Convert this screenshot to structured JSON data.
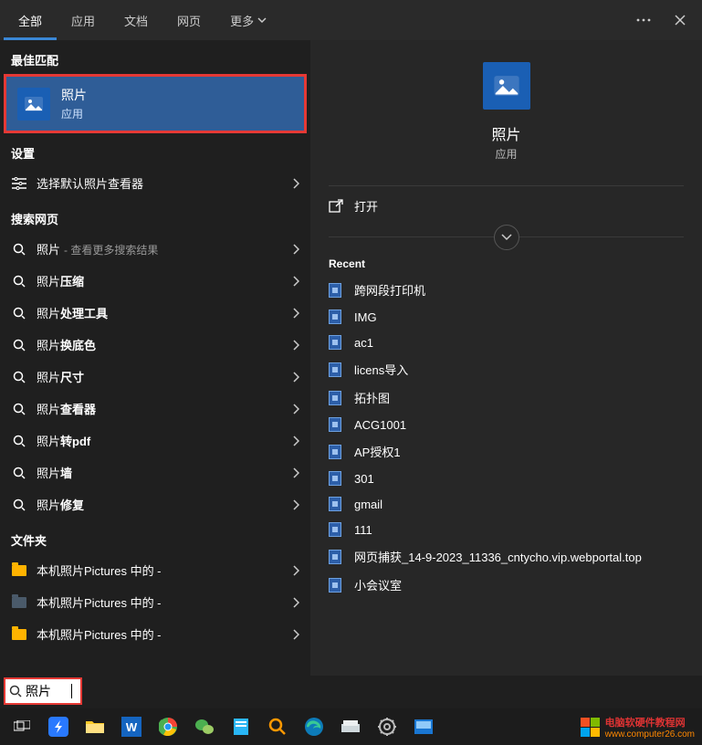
{
  "tabs": {
    "all": "全部",
    "apps": "应用",
    "docs": "文档",
    "web": "网页",
    "more": "更多"
  },
  "left": {
    "best_header": "最佳匹配",
    "best_title": "照片",
    "best_sub": "应用",
    "settings_header": "设置",
    "settings_item": "选择默认照片查看器",
    "web_header": "搜索网页",
    "web_items": [
      {
        "prefix": "照片",
        "suffix": " - 查看更多搜索结果"
      },
      {
        "prefix": "照片",
        "bold": "压缩"
      },
      {
        "prefix": "照片",
        "bold": "处理工具"
      },
      {
        "prefix": "照片",
        "bold": "换底色"
      },
      {
        "prefix": "照片",
        "bold": "尺寸"
      },
      {
        "prefix": "照片",
        "bold": "查看器"
      },
      {
        "prefix": "照片",
        "bold": "转pdf"
      },
      {
        "prefix": "照片",
        "bold": "墙"
      },
      {
        "prefix": "照片",
        "bold": "修复"
      }
    ],
    "folders_header": "文件夹",
    "folders": [
      {
        "name": "本机照片Pictures 中的 -"
      },
      {
        "name": "本机照片Pictures 中的 -"
      },
      {
        "name": "本机照片Pictures 中的 -"
      }
    ]
  },
  "right": {
    "title": "照片",
    "sub": "应用",
    "open": "打开",
    "recent_header": "Recent",
    "recent": [
      "跨网段打印机",
      "IMG",
      "ac1",
      "licens导入",
      "拓扑图",
      "ACG1001",
      "AP授权1",
      "301",
      "gmail",
      "111",
      "网页捕获_14-9-2023_11336_cntycho.vip.webportal.top",
      "小会议室"
    ]
  },
  "search": {
    "value": "照片"
  },
  "brand": {
    "line1": "电脑软硬件教程网",
    "line2": "www.computer26.com"
  }
}
